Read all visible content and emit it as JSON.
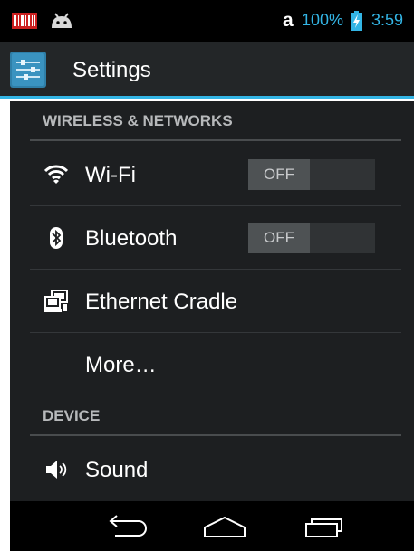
{
  "status_bar": {
    "carrier_letter": "a",
    "battery_percent": "100%",
    "time": "3:59",
    "icons": [
      "barcode-scanner-icon",
      "android-debug-icon",
      "battery-charging-icon"
    ]
  },
  "action_bar": {
    "title": "Settings",
    "icon": "settings-app-icon"
  },
  "sections": [
    {
      "header": "WIRELESS & NETWORKS",
      "items": [
        {
          "label": "Wi-Fi",
          "icon": "wifi-icon",
          "toggle": "OFF"
        },
        {
          "label": "Bluetooth",
          "icon": "bluetooth-icon",
          "toggle": "OFF"
        },
        {
          "label": "Ethernet Cradle",
          "icon": "ethernet-cradle-icon"
        },
        {
          "label": "More…"
        }
      ]
    },
    {
      "header": "DEVICE",
      "items": [
        {
          "label": "Sound",
          "icon": "speaker-icon"
        }
      ]
    }
  ],
  "nav_bar": {
    "buttons": [
      "back-icon",
      "home-icon",
      "recent-apps-icon"
    ]
  },
  "colors": {
    "accent": "#33b5e5",
    "background": "#1d1f21",
    "action_bar": "#232628",
    "text": "#ffffff",
    "header_text": "#b7b9bb"
  }
}
